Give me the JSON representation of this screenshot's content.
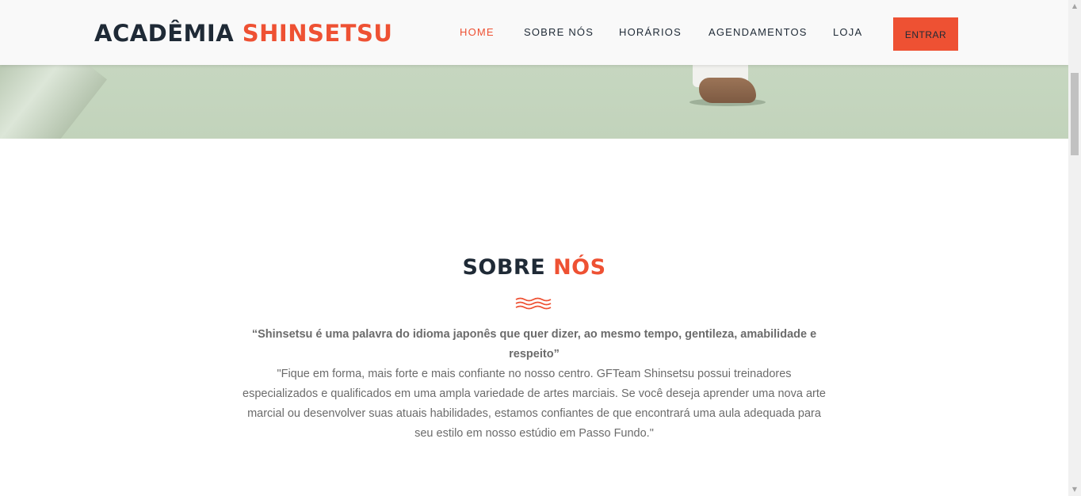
{
  "header": {
    "logo": {
      "part1": "ACADÊMIA",
      "part2": "SHINSETSU"
    },
    "nav": [
      {
        "label": "HOME",
        "active": true
      },
      {
        "label": "SOBRE NÓS",
        "active": false
      },
      {
        "label": "HORÁRIOS",
        "active": false
      },
      {
        "label": "AGENDAMENTOS",
        "active": false
      },
      {
        "label": "LOJA",
        "active": false
      }
    ],
    "login_label": "ENTRAR"
  },
  "about": {
    "title_part1": "SOBRE",
    "title_part2": "NÓS",
    "quote": "“Shinsetsu é uma palavra do idioma japonês que quer dizer, ao mesmo tempo, gentileza, amabilidade e respeito”",
    "description": "\"Fique em forma, mais forte e mais confiante no nosso centro. GFTeam Shinsetsu possui treinadores especializados e qualificados em uma ampla variedade de artes marciais. Se você deseja aprender uma nova arte marcial ou desenvolver suas atuais habilidades, estamos confiantes de que encontrará uma aula adequada para seu estilo em nosso estúdio em Passo Fundo.\""
  },
  "colors": {
    "accent": "#ee5133",
    "dark": "#1f2a36",
    "body_text": "#6b6b6b",
    "navbar_bg": "#f9f9f9"
  },
  "icons": {
    "divider": "wave-icon",
    "scroll_up": "scroll-up-arrow-icon",
    "scroll_down": "scroll-down-arrow-icon"
  }
}
